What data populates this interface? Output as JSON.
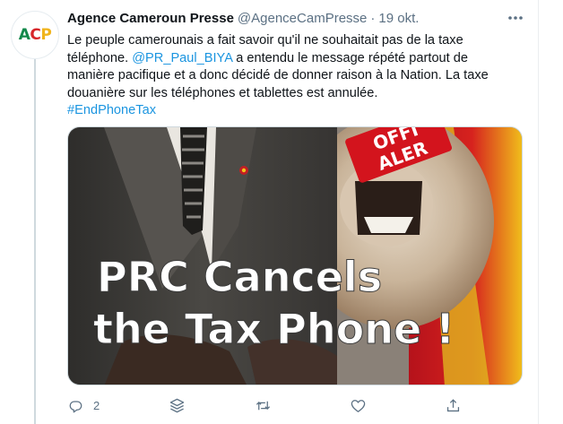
{
  "tweet": {
    "avatar": {
      "letter1": "A",
      "letter2": "C",
      "letter3": "P"
    },
    "author_name": "Agence Cameroun Presse",
    "handle": "@AgenceCamPresse",
    "separator": "·",
    "time": "19 okt.",
    "text_part1": "Le peuple camerounais a fait savoir qu'il ne souhaitait pas de la taxe téléphone. ",
    "mention": "@PR_Paul_BIYA",
    "text_part2": " a entendu le message répété partout de manière pacifique et a donc décidé de donner raison à la Nation. La taxe douanière sur les téléphones et tablettes est annulée.",
    "hashtag": "#EndPhoneTax",
    "media": {
      "headline_line1": "PRC Cancels",
      "headline_line2": "the Tax Phone !",
      "badge_line1": "OFFI",
      "badge_line2": "ALER"
    },
    "actions": {
      "reply_count": "2",
      "retweet_count": "",
      "like_count": ""
    }
  },
  "colors": {
    "link": "#1b95e0",
    "secondary_text": "#5b7083",
    "icon": "#5b7083"
  },
  "icons": [
    "more-icon",
    "reply-icon",
    "stack-icon",
    "retweet-icon",
    "like-icon",
    "share-icon"
  ]
}
